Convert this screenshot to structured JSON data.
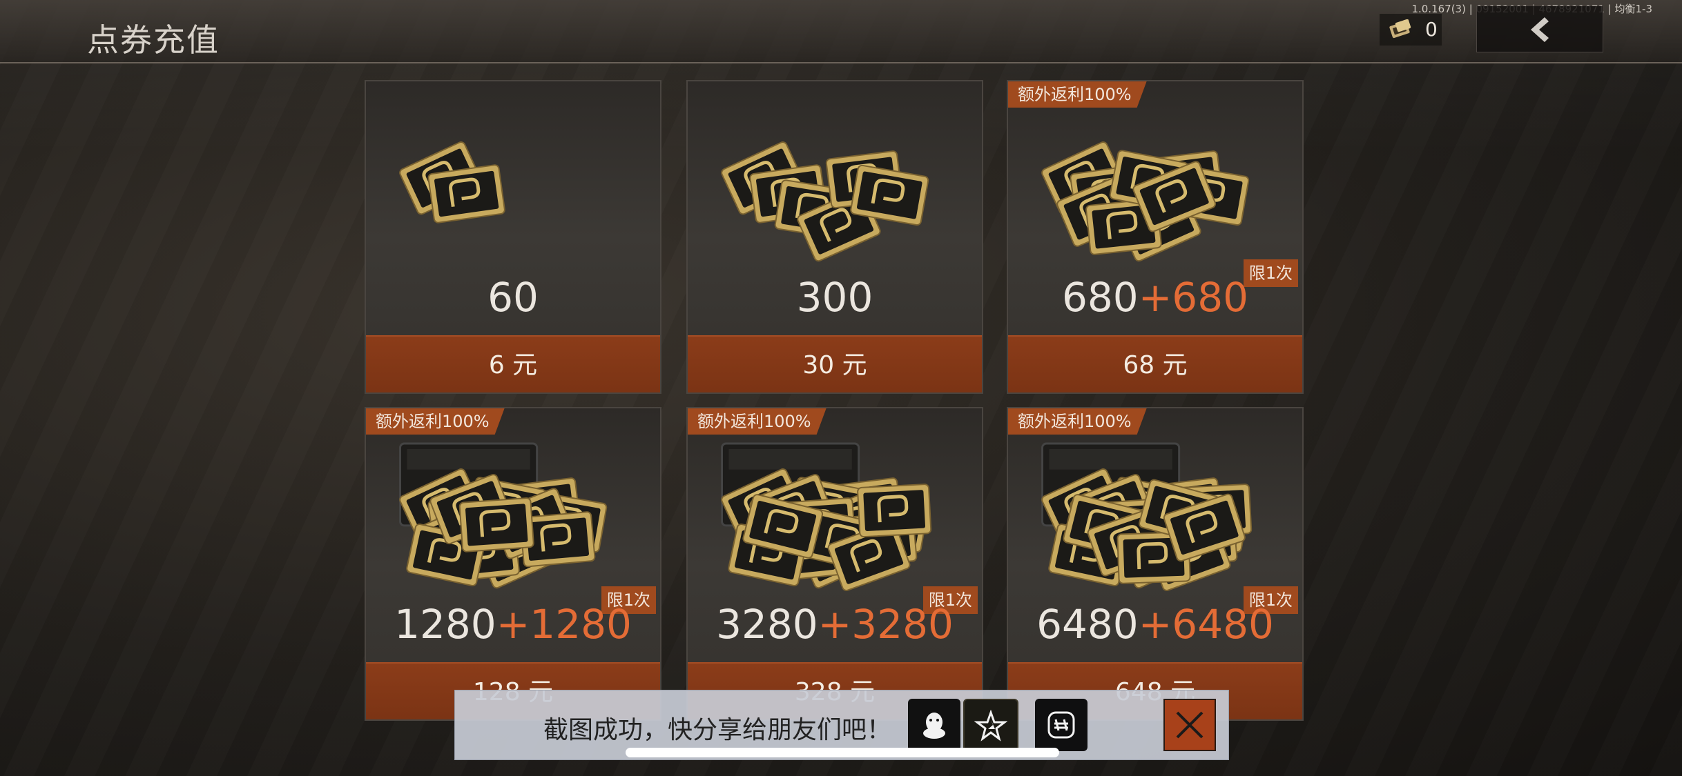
{
  "header": {
    "title": "点券充值",
    "version": "1.0.167(3) | 09152001 | 4678921071 | 均衡1-3",
    "currency_icon": "coupon-icon",
    "currency_count": "0",
    "back_icon": "chevron-left-icon"
  },
  "cards": [
    {
      "amount": "60",
      "bonus": "",
      "bonus_tag": "",
      "limit_tag": "",
      "price": "6 元"
    },
    {
      "amount": "300",
      "bonus": "",
      "bonus_tag": "",
      "limit_tag": "",
      "price": "30 元"
    },
    {
      "amount": "680",
      "bonus": "+680",
      "bonus_tag": "额外返利100%",
      "limit_tag": "限1次",
      "price": "68 元"
    },
    {
      "amount": "1280",
      "bonus": "+1280",
      "bonus_tag": "额外返利100%",
      "limit_tag": "限1次",
      "price": "128 元"
    },
    {
      "amount": "3280",
      "bonus": "+3280",
      "bonus_tag": "额外返利100%",
      "limit_tag": "限1次",
      "price": "328 元"
    },
    {
      "amount": "6480",
      "bonus": "+6480",
      "bonus_tag": "额外返利100%",
      "limit_tag": "限1次",
      "price": "648 元"
    }
  ],
  "share": {
    "message": "截图成功，快分享给朋友们吧！",
    "buttons": [
      "qq-icon",
      "qzone-star-icon",
      "wechat-moments-icon"
    ],
    "close_icon": "close-icon"
  },
  "colors": {
    "accent": "#a04a1e",
    "bonus_text": "#e46c36",
    "price_button": "#7a3314"
  }
}
